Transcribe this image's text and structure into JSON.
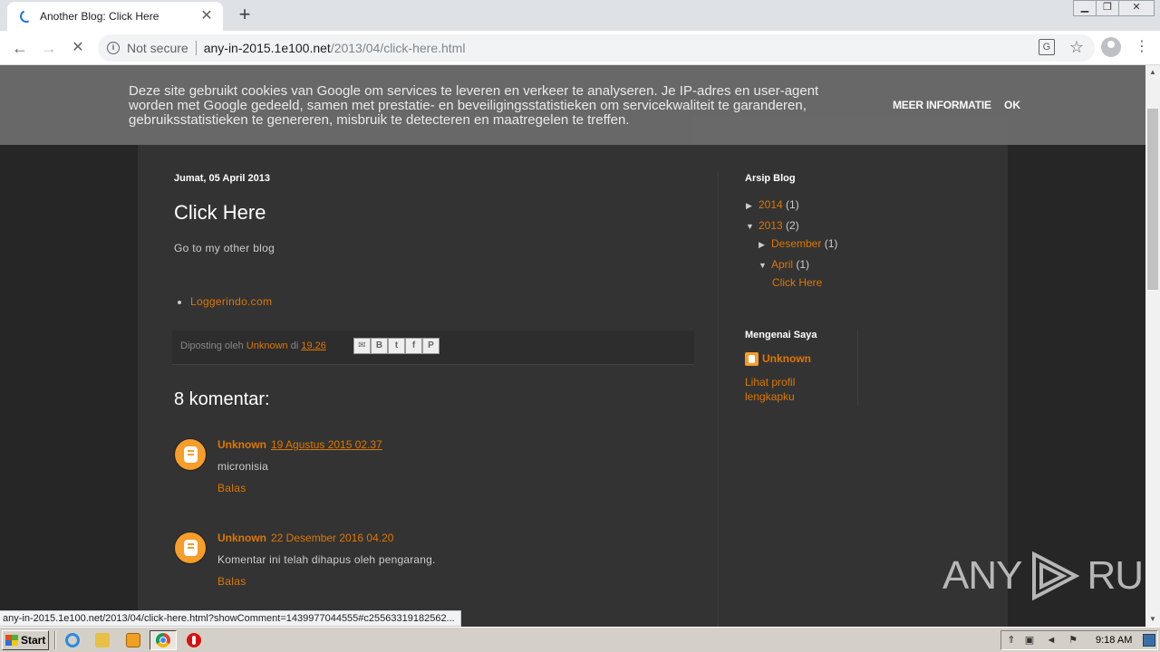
{
  "browser": {
    "tab_title": "Another Blog: Click Here",
    "tab_close": "✕",
    "new_tab": "+",
    "security_label": "Not secure",
    "url_host": "any-in-2015.1e100.net",
    "url_path": "/2013/04/click-here.html",
    "status_url": "any-in-2015.1e100.net/2013/04/click-here.html?showComment=1439977044555#c25563319182562..."
  },
  "cookie_notice": {
    "text": "Deze site gebruikt cookies van Google om services te leveren en verkeer te analyseren. Je IP-adres en user-agent worden met Google gedeeld, samen met prestatie- en beveiligingsstatistieken om servicekwaliteit te garanderen, gebruiksstatistieken te genereren, misbruik te detecteren en maatregelen te treffen.",
    "more_label": "MEER INFORMATIE",
    "ok_label": "OK"
  },
  "post": {
    "date": "Jumat, 05 April 2013",
    "title": "Click Here",
    "body": "Go to my other blog",
    "links": [
      "Loggerindo.com"
    ],
    "footer_prefix": "Diposting oleh",
    "footer_author": "Unknown",
    "footer_at": "di",
    "footer_time": "19.26",
    "share_buttons": [
      "email-icon",
      "blogger-icon",
      "twitter-icon",
      "facebook-icon",
      "pinterest-icon"
    ]
  },
  "comments": {
    "title": "8 komentar:",
    "items": [
      {
        "author": "Unknown",
        "time": "19 Agustus 2015 02.37",
        "text": "micronisia",
        "reply": "Balas"
      },
      {
        "author": "Unknown",
        "time": "22 Desember 2016 04.20",
        "text": "Komentar ini telah dihapus oleh pengarang.",
        "reply": "Balas"
      }
    ]
  },
  "sidebar": {
    "archive_title": "Arsip Blog",
    "archive": [
      {
        "label": "2014",
        "count": "(1)",
        "expanded": false
      },
      {
        "label": "2013",
        "count": "(2)",
        "expanded": true
      },
      {
        "label": "Desember",
        "count": "(1)",
        "expanded": false
      },
      {
        "label": "April",
        "count": "(1)",
        "expanded": true
      }
    ],
    "archive_post": "Click Here",
    "about_title": "Mengenai Saya",
    "profile_name": "Unknown",
    "profile_link": "Lihat profil lengkapku"
  },
  "watermark": {
    "left": "ANY",
    "right": "RUN"
  },
  "taskbar": {
    "start_label": "Start",
    "clock": "9:18 AM"
  },
  "colors": {
    "accent": "#dd7700",
    "page_bg": "#262626",
    "column_bg": "#333333",
    "cookie_bg": "#6a6a6a"
  }
}
